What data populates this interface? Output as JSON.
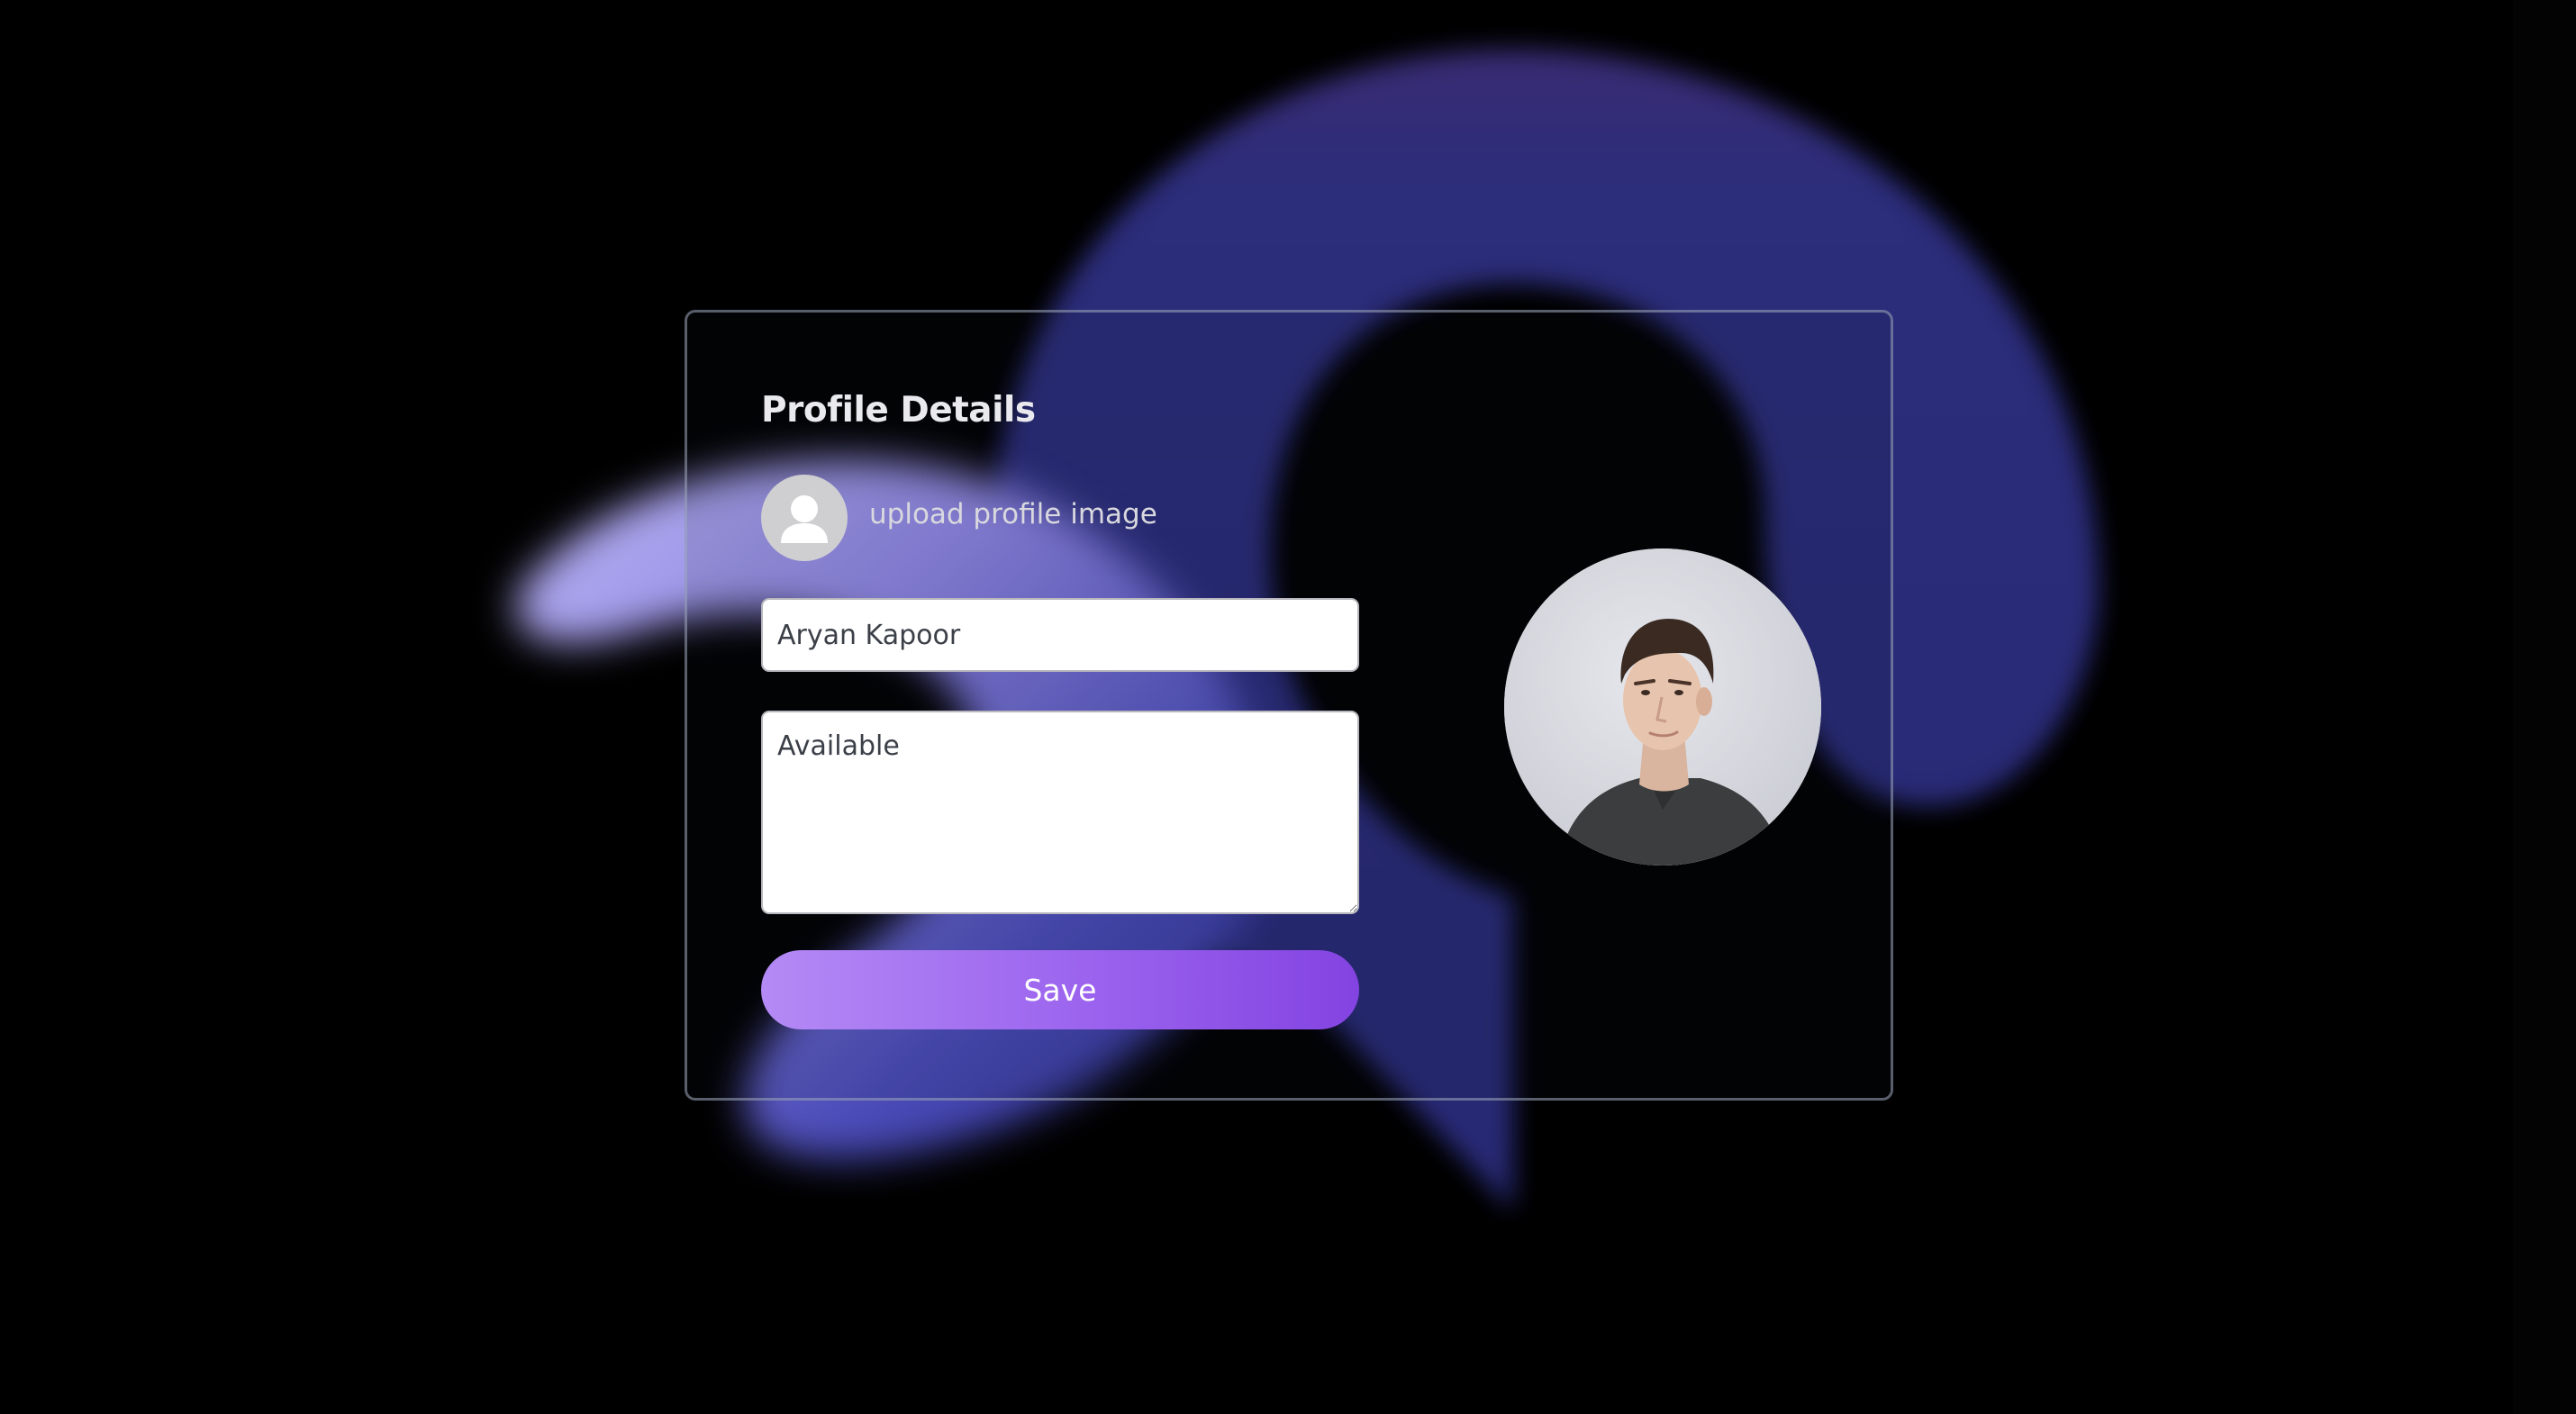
{
  "colors": {
    "background": "#000000",
    "accent_start": "#b48af5",
    "accent_end": "#8343e1",
    "ring": "#2c2f7e",
    "card_border": "#a0aabe"
  },
  "profile": {
    "title": "Profile Details",
    "upload_label": "upload profile image",
    "avatar_icon": "user-icon",
    "name_value": "Aryan Kapoor",
    "status_value": "Available",
    "save_label": "Save"
  }
}
